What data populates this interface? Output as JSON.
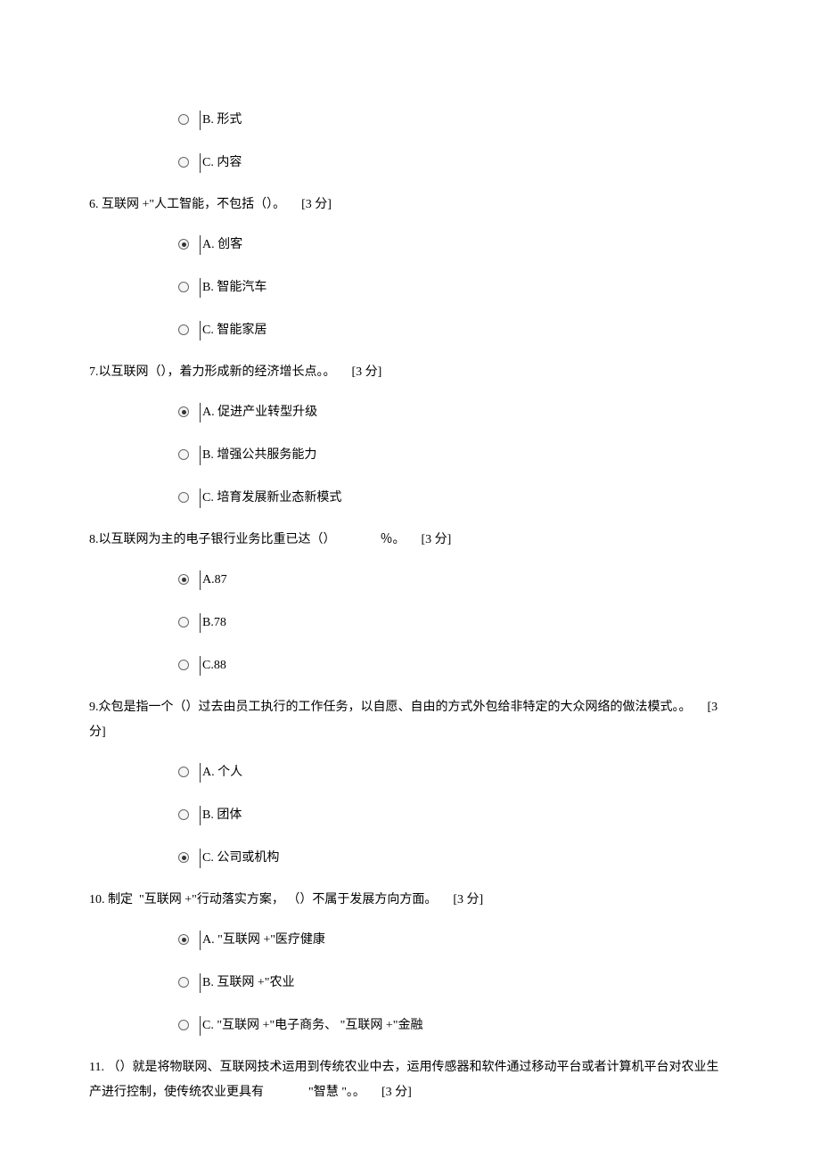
{
  "q5_options": [
    {
      "label": "B. 形式"
    },
    {
      "label": "C. 内容"
    }
  ],
  "q6": {
    "prefix": "6. ",
    "text": "互联网 +\"人工智能，不包括（）。",
    "score": "[3 分]",
    "options": [
      {
        "label": "A. 创客",
        "selected": true
      },
      {
        "label": "B. 智能汽车"
      },
      {
        "label": "C. 智能家居"
      }
    ]
  },
  "q7": {
    "prefix": "7.",
    "text": "以互联网（），着力形成新的经济增长点。。",
    "score": "[3 分]",
    "options": [
      {
        "label": "A. 促进产业转型升级",
        "selected": true
      },
      {
        "label": "B. 增强公共服务能力"
      },
      {
        "label": "C. 培育发展新业态新模式"
      }
    ]
  },
  "q8": {
    "prefix": "8.",
    "text_a": "以互联网为主的电子银行业务比重已达（）",
    "text_b": "％。",
    "score": "[3 分]",
    "options": [
      {
        "label": "A.87",
        "selected": true
      },
      {
        "label": "B.78"
      },
      {
        "label": "C.88"
      }
    ]
  },
  "q9": {
    "prefix": "9.",
    "text": "众包是指一个（）过去由员工执行的工作任务，以自愿、自由的方式外包给非特定的大众网络的做法模式。。",
    "score": "[3 分]",
    "options": [
      {
        "label": "A. 个人"
      },
      {
        "label": "B. 团体"
      },
      {
        "label": "C. 公司或机构",
        "selected": true
      }
    ]
  },
  "q10": {
    "prefix": "10. ",
    "text_a": "制定",
    "text_b": "\"互联网 +\"行动落实方案， （）不属于发展方向方面。",
    "score": "[3 分]",
    "options": [
      {
        "label": "A. \"互联网 +\"医疗健康",
        "selected": true
      },
      {
        "label": "B. 互联网 +\"农业"
      },
      {
        "label": "C. \"互联网 +\"电子商务、 \"互联网 +\"金融"
      }
    ]
  },
  "q11": {
    "prefix": "11. ",
    "text_a": "（）就是将物联网、互联网技术运用到传统农业中去，运用传感器和软件通过移动平台或者计算机平台对农业生产进行控制，使传统农业更具有",
    "text_b": "\"智慧 \"。。",
    "score": "[3 分]"
  }
}
